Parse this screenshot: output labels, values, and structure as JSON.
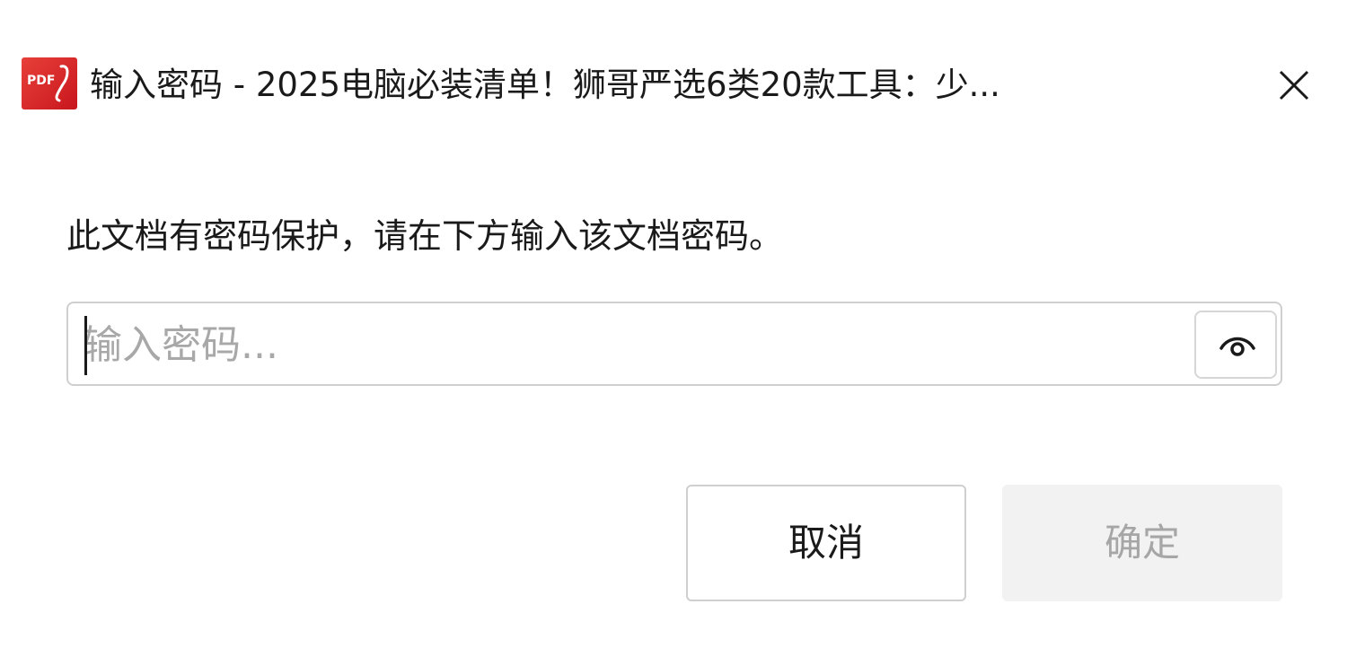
{
  "window": {
    "icon": "pdf-app-icon",
    "icon_text": "PDF",
    "title": "输入密码 - 2025电脑必装清单！狮哥严选6类20款工具：少...",
    "close_icon": "close-icon"
  },
  "dialog": {
    "message": "此文档有密码保护，请在下方输入该文档密码。",
    "password": {
      "value": "",
      "placeholder": "输入密码...",
      "toggle_icon": "eye-icon"
    },
    "buttons": {
      "cancel_label": "取消",
      "confirm_label": "确定"
    }
  },
  "colors": {
    "icon_red": "#d82a24",
    "placeholder": "#a8a8a8",
    "disabled_button_bg": "#f2f2f2",
    "disabled_button_text": "#a6a6a6",
    "border": "#cfcfcf"
  }
}
